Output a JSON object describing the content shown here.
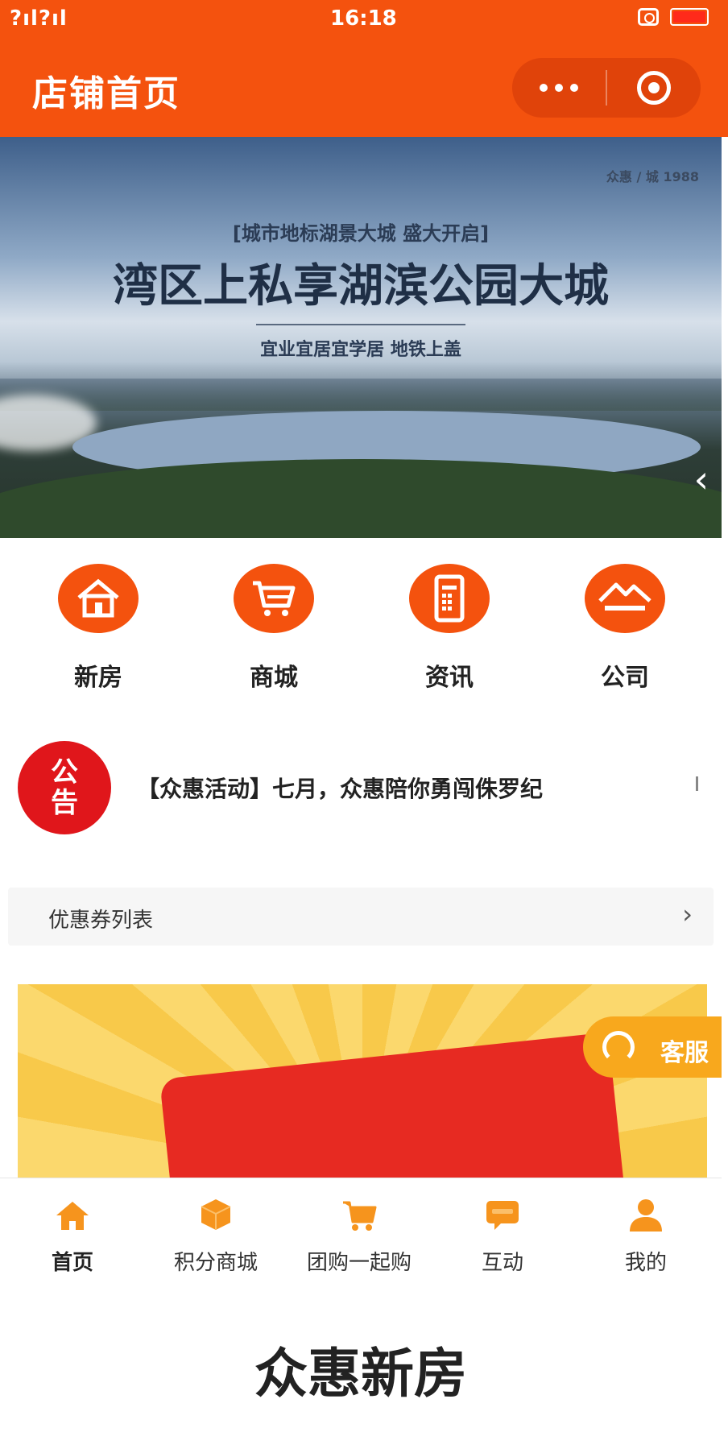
{
  "status_bar": {
    "signal": "?ıl?ıl",
    "time": "16:18"
  },
  "header": {
    "title": "店铺首页",
    "more_icon": "more-dots-icon",
    "close_icon": "target-circle-icon"
  },
  "banner": {
    "logos": "众惠 / 城 1988",
    "subtitle": "[城市地标湖景大城 盛大开启]",
    "title": "湾区上私享湖滨公园大城",
    "tagline": "宜业宜居宜学居 地铁上盖",
    "arrow_icon": "chevron-left-icon"
  },
  "nav": {
    "items": [
      {
        "label": "新房",
        "icon": "house-icon"
      },
      {
        "label": "商城",
        "icon": "cart-icon"
      },
      {
        "label": "资讯",
        "icon": "phone-icon"
      },
      {
        "label": "公司",
        "icon": "company-icon"
      }
    ]
  },
  "notice": {
    "badge_top": "公",
    "badge_bottom": "告",
    "text": "【众惠活动】七月，众惠陪你勇闯侏罗纪"
  },
  "coupon": {
    "label": "优惠券列表",
    "chevron": "›"
  },
  "service": {
    "label": "客服",
    "icon": "headset-icon"
  },
  "tab_bar": {
    "items": [
      {
        "label": "首页",
        "icon": "home-icon",
        "active": true
      },
      {
        "label": "积分商城",
        "icon": "box-icon",
        "active": false
      },
      {
        "label": "团购一起购",
        "icon": "basket-icon",
        "active": false
      },
      {
        "label": "互动",
        "icon": "chat-icon",
        "active": false
      },
      {
        "label": "我的",
        "icon": "user-icon",
        "active": false
      }
    ]
  },
  "footer": {
    "title": "众惠新房"
  },
  "colors": {
    "brand_orange": "#f4520e",
    "notice_red": "#e0161b",
    "service_orange": "#f8a81d",
    "tab_icon_orange": "#f6941d"
  }
}
